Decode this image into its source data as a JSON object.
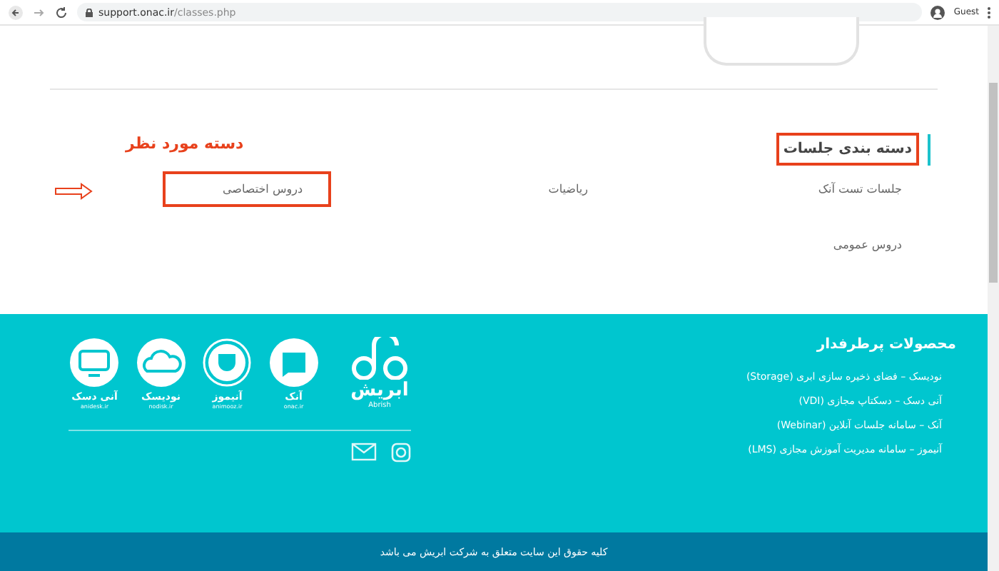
{
  "browser": {
    "url_host": "support.onac.ir",
    "url_path": "/classes.php",
    "profile": "Guest"
  },
  "categories": {
    "title": "دسته بندی جلسات",
    "title_highlighted": true,
    "annotation": "دسته مورد نظر",
    "items": [
      {
        "label": "جلسات تست آنک",
        "highlighted": false
      },
      {
        "label": "ریاضیات",
        "highlighted": false
      },
      {
        "label": "دروس اختصاصی",
        "highlighted": true
      },
      {
        "label": "دروس عمومی",
        "highlighted": false
      }
    ]
  },
  "footer": {
    "products_title": "محصولات پرطرفدار",
    "products": [
      "نودیسک – فضای ذخیره سازی ابری (Storage)",
      "آنی دسک – دسکتاپ مجازی (VDI)",
      "آنک – سامانه جلسات آنلاین (Webinar)",
      "آنیموز – سامانه مدیریت آموزش مجازی (LMS)"
    ],
    "brand": {
      "name": "ابریش",
      "latin": "Abrish"
    },
    "apps": [
      {
        "kind": "onac",
        "name": "آنک",
        "site": "onac.ir"
      },
      {
        "kind": "animooz",
        "name": "آنیموز",
        "site": "animooz.ir"
      },
      {
        "kind": "nodisk",
        "name": "نودیسک",
        "site": "nodisk.ir"
      },
      {
        "kind": "anidesk",
        "name": "آنی دسک",
        "site": "anidesk.ir"
      }
    ],
    "copyright": "کلیه حقوق این سایت متعلق به شرکت ابریش می باشد"
  }
}
